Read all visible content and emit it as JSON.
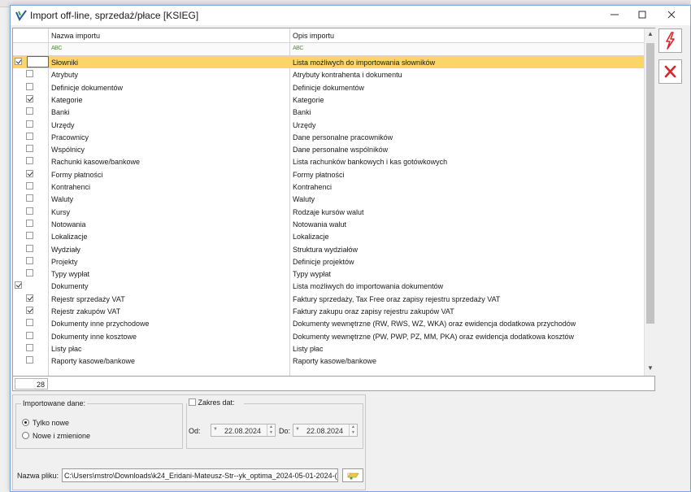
{
  "window": {
    "title": "Import off-line, sprzedaż/płace [KSIEG]"
  },
  "grid": {
    "headers": {
      "name": "Nazwa importu",
      "desc": "Opis importu"
    },
    "filter_icon_text": "ABC",
    "rows": [
      {
        "level": 1,
        "checked": true,
        "selected": true,
        "name": "Słowniki",
        "desc": "Lista możliwych do importowania słowników"
      },
      {
        "level": 2,
        "checked": false,
        "selected": false,
        "name": "Atrybuty",
        "desc": "Atrybuty kontrahenta i dokumentu"
      },
      {
        "level": 2,
        "checked": false,
        "selected": false,
        "name": "Definicje dokumentów",
        "desc": "Definicje dokumentów"
      },
      {
        "level": 2,
        "checked": true,
        "selected": false,
        "name": "Kategorie",
        "desc": "Kategorie"
      },
      {
        "level": 2,
        "checked": false,
        "selected": false,
        "name": "Banki",
        "desc": "Banki"
      },
      {
        "level": 2,
        "checked": false,
        "selected": false,
        "name": "Urzędy",
        "desc": "Urzędy"
      },
      {
        "level": 2,
        "checked": false,
        "selected": false,
        "name": "Pracownicy",
        "desc": "Dane personalne pracowników"
      },
      {
        "level": 2,
        "checked": false,
        "selected": false,
        "name": "Wspólnicy",
        "desc": "Dane personalne wspólników"
      },
      {
        "level": 2,
        "checked": false,
        "selected": false,
        "name": "Rachunki kasowe/bankowe",
        "desc": "Lista rachunków bankowych i kas gotówkowych"
      },
      {
        "level": 2,
        "checked": true,
        "selected": false,
        "name": "Formy płatności",
        "desc": "Formy płatności"
      },
      {
        "level": 2,
        "checked": false,
        "selected": false,
        "name": "Kontrahenci",
        "desc": "Kontrahenci"
      },
      {
        "level": 2,
        "checked": false,
        "selected": false,
        "name": "Waluty",
        "desc": "Waluty"
      },
      {
        "level": 2,
        "checked": false,
        "selected": false,
        "name": "Kursy",
        "desc": "Rodzaje kursów walut"
      },
      {
        "level": 2,
        "checked": false,
        "selected": false,
        "name": "Notowania",
        "desc": "Notowania walut"
      },
      {
        "level": 2,
        "checked": false,
        "selected": false,
        "name": "Lokalizacje",
        "desc": "Lokalizacje"
      },
      {
        "level": 2,
        "checked": false,
        "selected": false,
        "name": "Wydziały",
        "desc": "Struktura wydziałów"
      },
      {
        "level": 2,
        "checked": false,
        "selected": false,
        "name": "Projekty",
        "desc": "Definicje projektów"
      },
      {
        "level": 2,
        "checked": false,
        "selected": false,
        "name": "Typy wypłat",
        "desc": "Typy wypłat"
      },
      {
        "level": 1,
        "checked": true,
        "selected": false,
        "name": "Dokumenty",
        "desc": "Lista możliwych do importowania dokumentów"
      },
      {
        "level": 2,
        "checked": true,
        "selected": false,
        "name": "Rejestr sprzedaży VAT",
        "desc": "Faktury sprzedaży, Tax Free oraz zapisy rejestru sprzedaży VAT"
      },
      {
        "level": 2,
        "checked": true,
        "selected": false,
        "name": "Rejestr zakupów VAT",
        "desc": "Faktury zakupu oraz zapisy rejestru zakupów VAT"
      },
      {
        "level": 2,
        "checked": false,
        "selected": false,
        "name": "Dokumenty inne przychodowe",
        "desc": "Dokumenty wewnętrzne (RW, RWS, WZ, WKA) oraz ewidencja dodatkowa przychodów"
      },
      {
        "level": 2,
        "checked": false,
        "selected": false,
        "name": "Dokumenty inne kosztowe",
        "desc": "Dokumenty wewnętrzne (PW, PWP, PZ, MM, PKA) oraz ewidencja dodatkowa kosztów"
      },
      {
        "level": 2,
        "checked": false,
        "selected": false,
        "name": "Listy płac",
        "desc": "Listy płac"
      },
      {
        "level": 2,
        "checked": false,
        "selected": false,
        "name": "Raporty kasowe/bankowe",
        "desc": "Raporty kasowe/bankowe"
      }
    ],
    "count": "28"
  },
  "toolbar": {
    "run_icon": "lightning-icon",
    "cancel_icon": "close-x-icon",
    "colors": {
      "icon_red": "#d9252c",
      "selected_row": "#fbd568"
    }
  },
  "imported": {
    "legend": "Importowane dane:",
    "options": [
      {
        "label": "Tylko nowe",
        "selected": true
      },
      {
        "label": "Nowe i zmienione",
        "selected": false
      }
    ]
  },
  "date_range": {
    "checkbox_label": "Zakres dat:",
    "checked": false,
    "from_label": "Od:",
    "from_value": "22.08.2024",
    "to_label": "Do:",
    "to_value": "22.08.2024"
  },
  "file": {
    "label": "Nazwa pliku:",
    "value": "C:\\Users\\mstro\\Downloads\\k24_Eridani-Mateusz-Str--yk_optima_2024-05-01-2024-("
  }
}
